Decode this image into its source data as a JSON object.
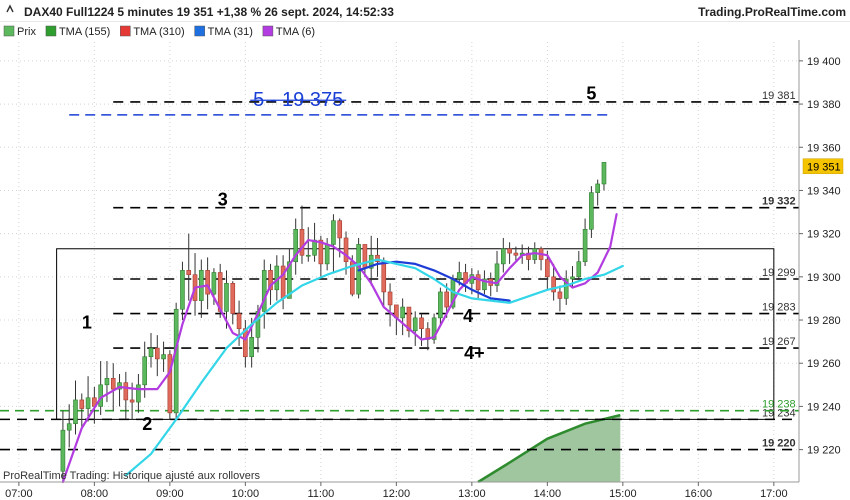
{
  "header": {
    "instrument_line": "DAX40 Full1224 5 minutes 19 351 +1,38 % 26 sept. 2024, 14:52:33",
    "brand": "Trading.ProRealTime.com"
  },
  "legend": [
    {
      "label": "Prix",
      "color": "#5cb85c"
    },
    {
      "label": "TMA (155)",
      "color": "#2e9e2e"
    },
    {
      "label": "TMA (310)",
      "color": "#e53935"
    },
    {
      "label": "TMA (31)",
      "color": "#1e6fe0"
    },
    {
      "label": "TMA (6)",
      "color": "#b23ce0"
    }
  ],
  "footer": {
    "note": "ProRealTime Trading: Historique ajusté aux rollovers"
  },
  "chart_data": {
    "type": "candlestick",
    "x_axis": {
      "range": [
        "06:45",
        "17:20"
      ],
      "ticks": [
        "07:00",
        "08:00",
        "09:00",
        "10:00",
        "11:00",
        "12:00",
        "13:00",
        "14:00",
        "15:00",
        "16:00",
        "17:00"
      ]
    },
    "y_axis": {
      "range": [
        19205,
        19418
      ],
      "ticks": [
        "19 220",
        "19 240",
        "19 260",
        "19 280",
        "19 300",
        "19 320",
        "19 340",
        "19 360",
        "19 380",
        "19 400"
      ]
    },
    "current_price": {
      "value": 19351,
      "label": "19 351",
      "color": "#f5c400"
    },
    "levels": [
      {
        "value": 19381,
        "label": "19 381",
        "style": "black-dashed",
        "start": "08:15",
        "bold": false
      },
      {
        "value": 19332,
        "label": "19 332",
        "style": "black-dashed",
        "start": "08:15",
        "bold": true
      },
      {
        "value": 19299,
        "label": "19 299",
        "style": "black-dashed",
        "start": "08:15",
        "bold": false
      },
      {
        "value": 19283,
        "label": "19 283",
        "style": "black-dashed",
        "start": "08:15",
        "bold": false
      },
      {
        "value": 19267,
        "label": "19 267",
        "style": "black-dashed",
        "start": "08:15",
        "bold": false
      },
      {
        "value": 19234,
        "label": "19 234",
        "style": "black-dashed",
        "start": "06:45",
        "bold": false
      },
      {
        "value": 19220,
        "label": "19 220",
        "style": "black-dashed",
        "start": "06:45",
        "bold": true
      },
      {
        "value": 19238,
        "label": "19 238",
        "style": "green-dashed",
        "start": "06:45",
        "bold": false
      }
    ],
    "target_line": {
      "value": 19375,
      "start": "07:40",
      "end": "14:50",
      "color": "#1a3fd6"
    },
    "annotations": [
      {
        "text": "5 - 19 375",
        "x": "10:42",
        "y": 19379,
        "color": "#1a3fd6",
        "strike": true
      },
      {
        "text": "5",
        "x": "14:35",
        "y": 19382,
        "color": "#000000",
        "strike": false
      },
      {
        "text": "3",
        "x": "09:42",
        "y": 19333,
        "color": "#000000",
        "strike": false
      },
      {
        "text": "1",
        "x": "07:54",
        "y": 19276,
        "color": "#000000",
        "strike": false
      },
      {
        "text": "2",
        "x": "08:42",
        "y": 19229,
        "color": "#000000",
        "strike": false
      },
      {
        "text": "4",
        "x": "12:57",
        "y": 19279,
        "color": "#000000",
        "strike": false
      },
      {
        "text": "4+",
        "x": "13:02",
        "y": 19262,
        "color": "#000000",
        "strike": false
      }
    ],
    "box": {
      "x": [
        "07:30",
        "17:00"
      ],
      "y": [
        19234,
        19313
      ]
    },
    "candles": [
      [
        19210,
        19229,
        19205,
        19238
      ],
      [
        19229,
        19232,
        19221,
        19241
      ],
      [
        19232,
        19243,
        19227,
        19252
      ],
      [
        19243,
        19239,
        19230,
        19246
      ],
      [
        19239,
        19244,
        19233,
        19254
      ],
      [
        19244,
        19240,
        19232,
        19249
      ],
      [
        19240,
        19250,
        19236,
        19261
      ],
      [
        19250,
        19253,
        19242,
        19261
      ],
      [
        19253,
        19248,
        19238,
        19260
      ],
      [
        19248,
        19251,
        19240,
        19255
      ],
      [
        19251,
        19243,
        19234,
        19256
      ],
      [
        19243,
        19242,
        19234,
        19251
      ],
      [
        19242,
        19250,
        19237,
        19255
      ],
      [
        19250,
        19263,
        19244,
        19270
      ],
      [
        19263,
        19267,
        19258,
        19274
      ],
      [
        19267,
        19262,
        19254,
        19273
      ],
      [
        19262,
        19264,
        19256,
        19270
      ],
      [
        19264,
        19237,
        19234,
        19266
      ],
      [
        19237,
        19285,
        19234,
        19288
      ],
      [
        19285,
        19303,
        19280,
        19307
      ],
      [
        19303,
        19301,
        19289,
        19320
      ],
      [
        19301,
        19289,
        19282,
        19311
      ],
      [
        19289,
        19303,
        19281,
        19308
      ],
      [
        19303,
        19292,
        19285,
        19309
      ],
      [
        19292,
        19302,
        19287,
        19304
      ],
      [
        19302,
        19284,
        19281,
        19306
      ],
      [
        19284,
        19297,
        19276,
        19303
      ],
      [
        19297,
        19283,
        19278,
        19298
      ],
      [
        19283,
        19276,
        19268,
        19289
      ],
      [
        19276,
        19263,
        19258,
        19280
      ],
      [
        19263,
        19272,
        19258,
        19281
      ],
      [
        19272,
        19284,
        19265,
        19287
      ],
      [
        19284,
        19303,
        19276,
        19308
      ],
      [
        19303,
        19294,
        19287,
        19306
      ],
      [
        19294,
        19305,
        19289,
        19310
      ],
      [
        19305,
        19290,
        19285,
        19310
      ],
      [
        19290,
        19307,
        19290,
        19313
      ],
      [
        19307,
        19322,
        19301,
        19327
      ],
      [
        19322,
        19310,
        19306,
        19333
      ],
      [
        19310,
        19310,
        19307,
        19323
      ],
      [
        19310,
        19317,
        19307,
        19325
      ],
      [
        19317,
        19306,
        19300,
        19319
      ],
      [
        19306,
        19315,
        19303,
        19318
      ],
      [
        19315,
        19326,
        19302,
        19329
      ],
      [
        19326,
        19318,
        19309,
        19327
      ],
      [
        19318,
        19307,
        19301,
        19321
      ],
      [
        19307,
        19292,
        19291,
        19310
      ],
      [
        19292,
        19315,
        19290,
        19318
      ],
      [
        19315,
        19304,
        19300,
        19315
      ],
      [
        19304,
        19310,
        19296,
        19319
      ],
      [
        19310,
        19307,
        19300,
        19318
      ],
      [
        19307,
        19293,
        19286,
        19309
      ],
      [
        19293,
        19287,
        19277,
        19297
      ],
      [
        19287,
        19281,
        19273,
        19286
      ],
      [
        19281,
        19286,
        19273,
        19290
      ],
      [
        19286,
        19275,
        19272,
        19284
      ],
      [
        19275,
        19281,
        19268,
        19284
      ],
      [
        19281,
        19276,
        19268,
        19283
      ],
      [
        19276,
        19271,
        19266,
        19279
      ],
      [
        19271,
        19281,
        19269,
        19283
      ],
      [
        19281,
        19293,
        19278,
        19295
      ],
      [
        19293,
        19286,
        19281,
        19297
      ],
      [
        19286,
        19299,
        19285,
        19301
      ],
      [
        19299,
        19302,
        19296,
        19307
      ],
      [
        19302,
        19297,
        19293,
        19306
      ],
      [
        19297,
        19301,
        19292,
        19304
      ],
      [
        19301,
        19294,
        19290,
        19303
      ],
      [
        19294,
        19299,
        19292,
        19303
      ],
      [
        19299,
        19296,
        19291,
        19302
      ],
      [
        19296,
        19306,
        19293,
        19312
      ],
      [
        19306,
        19313,
        19302,
        19318
      ],
      [
        19313,
        19311,
        19306,
        19316
      ],
      [
        19311,
        19310,
        19307,
        19314
      ],
      [
        19310,
        19311,
        19306,
        19315
      ],
      [
        19311,
        19308,
        19303,
        19314
      ],
      [
        19308,
        19313,
        19306,
        19316
      ],
      [
        19313,
        19308,
        19303,
        19314
      ],
      [
        19308,
        19300,
        19294,
        19312
      ],
      [
        19300,
        19293,
        19289,
        19306
      ],
      [
        19293,
        19290,
        19284,
        19296
      ],
      [
        19290,
        19299,
        19287,
        19303
      ],
      [
        19299,
        19300,
        19295,
        19305
      ],
      [
        19300,
        19307,
        19298,
        19312
      ],
      [
        19307,
        19322,
        19305,
        19327
      ],
      [
        19322,
        19339,
        19318,
        19342
      ],
      [
        19339,
        19343,
        19333,
        19345
      ],
      [
        19343,
        19353,
        19340,
        19353
      ]
    ],
    "series": [
      {
        "name": "TMA (6)",
        "color": "#b23ce0",
        "points": [
          [
            "07:35",
            19205
          ],
          [
            "07:50",
            19230
          ],
          [
            "08:05",
            19244
          ],
          [
            "08:20",
            19249
          ],
          [
            "08:35",
            19248
          ],
          [
            "08:50",
            19248
          ],
          [
            "09:00",
            19256
          ],
          [
            "09:10",
            19278
          ],
          [
            "09:20",
            19295
          ],
          [
            "09:30",
            19296
          ],
          [
            "09:40",
            19285
          ],
          [
            "09:50",
            19274
          ],
          [
            "10:00",
            19271
          ],
          [
            "10:10",
            19283
          ],
          [
            "10:20",
            19296
          ],
          [
            "10:30",
            19301
          ],
          [
            "10:40",
            19310
          ],
          [
            "10:50",
            19317
          ],
          [
            "11:00",
            19316
          ],
          [
            "11:10",
            19314
          ],
          [
            "11:20",
            19310
          ],
          [
            "11:30",
            19305
          ],
          [
            "11:40",
            19297
          ],
          [
            "11:50",
            19286
          ],
          [
            "12:00",
            19281
          ],
          [
            "12:10",
            19276
          ],
          [
            "12:20",
            19271
          ],
          [
            "12:30",
            19272
          ],
          [
            "12:40",
            19283
          ],
          [
            "12:50",
            19294
          ],
          [
            "13:00",
            19300
          ],
          [
            "13:10",
            19298
          ],
          [
            "13:20",
            19297
          ],
          [
            "13:30",
            19304
          ],
          [
            "13:40",
            19310
          ],
          [
            "13:50",
            19311
          ],
          [
            "14:00",
            19310
          ],
          [
            "14:10",
            19300
          ],
          [
            "14:20",
            19295
          ],
          [
            "14:30",
            19297
          ],
          [
            "14:40",
            19302
          ],
          [
            "14:50",
            19314
          ],
          [
            "14:55",
            19329
          ]
        ]
      },
      {
        "name": "TMA (31)",
        "color": "#1e3cd6",
        "points": [
          [
            "11:30",
            19303
          ],
          [
            "11:45",
            19306
          ],
          [
            "12:00",
            19307
          ],
          [
            "12:15",
            19306
          ],
          [
            "12:30",
            19303
          ],
          [
            "12:45",
            19299
          ],
          [
            "13:00",
            19294
          ],
          [
            "13:15",
            19290
          ],
          [
            "13:30",
            19289
          ]
        ]
      },
      {
        "name": "TMA (155)",
        "color": "#33d6e8",
        "points": [
          [
            "08:25",
            19208
          ],
          [
            "08:45",
            19218
          ],
          [
            "09:05",
            19234
          ],
          [
            "09:25",
            19251
          ],
          [
            "09:45",
            19267
          ],
          [
            "10:05",
            19278
          ],
          [
            "10:25",
            19288
          ],
          [
            "10:45",
            19296
          ],
          [
            "11:05",
            19301
          ],
          [
            "11:25",
            19305
          ],
          [
            "11:45",
            19308
          ],
          [
            "12:00",
            19306
          ],
          [
            "12:15",
            19304
          ],
          [
            "12:30",
            19299
          ],
          [
            "12:45",
            19293
          ],
          [
            "13:00",
            19290
          ],
          [
            "13:15",
            19289
          ],
          [
            "13:30",
            19288
          ],
          [
            "13:45",
            19291
          ],
          [
            "14:00",
            19294
          ],
          [
            "14:15",
            19296
          ],
          [
            "14:30",
            19299
          ],
          [
            "14:45",
            19301
          ],
          [
            "15:00",
            19305
          ]
        ]
      }
    ],
    "green_area": {
      "color": "#2e8b2e",
      "points": [
        [
          "13:05",
          19205
        ],
        [
          "13:30",
          19214
        ],
        [
          "14:00",
          19225
        ],
        [
          "14:30",
          19232
        ],
        [
          "14:58",
          19236
        ]
      ]
    }
  }
}
